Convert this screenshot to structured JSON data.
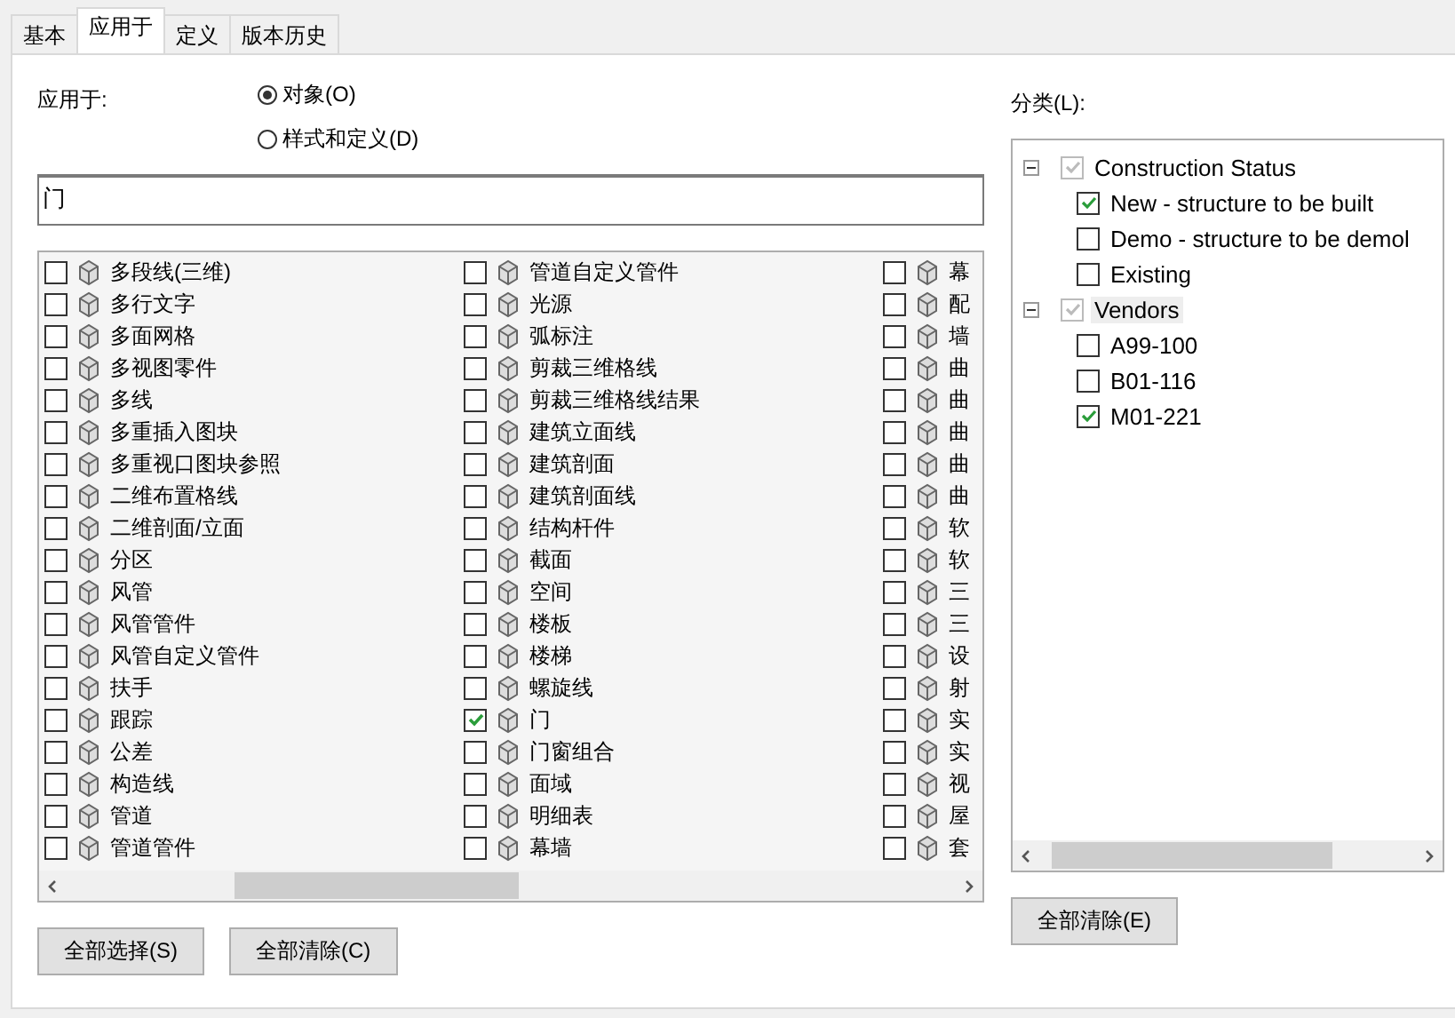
{
  "tabs": [
    {
      "label": "基本",
      "selected": false
    },
    {
      "label": "应用于",
      "selected": true
    },
    {
      "label": "定义",
      "selected": false
    },
    {
      "label": "版本历史",
      "selected": false
    }
  ],
  "apply_to": {
    "label": "应用于:",
    "options": [
      {
        "label": "对象(O)",
        "selected": true
      },
      {
        "label": "样式和定义(D)",
        "selected": false
      }
    ]
  },
  "filter": {
    "value": "门"
  },
  "object_list": {
    "columns": [
      [
        {
          "label": "多段线(三维)",
          "checked": false
        },
        {
          "label": "多行文字",
          "checked": false
        },
        {
          "label": "多面网格",
          "checked": false
        },
        {
          "label": "多视图零件",
          "checked": false
        },
        {
          "label": "多线",
          "checked": false
        },
        {
          "label": "多重插入图块",
          "checked": false
        },
        {
          "label": "多重视口图块参照",
          "checked": false
        },
        {
          "label": "二维布置格线",
          "checked": false
        },
        {
          "label": "二维剖面/立面",
          "checked": false
        },
        {
          "label": "分区",
          "checked": false
        },
        {
          "label": "风管",
          "checked": false
        },
        {
          "label": "风管管件",
          "checked": false
        },
        {
          "label": "风管自定义管件",
          "checked": false
        },
        {
          "label": "扶手",
          "checked": false
        },
        {
          "label": "跟踪",
          "checked": false
        },
        {
          "label": "公差",
          "checked": false
        },
        {
          "label": "构造线",
          "checked": false
        },
        {
          "label": "管道",
          "checked": false
        },
        {
          "label": "管道管件",
          "checked": false
        }
      ],
      [
        {
          "label": "管道自定义管件",
          "checked": false
        },
        {
          "label": "光源",
          "checked": false
        },
        {
          "label": "弧标注",
          "checked": false
        },
        {
          "label": "剪裁三维格线",
          "checked": false
        },
        {
          "label": "剪裁三维格线结果",
          "checked": false
        },
        {
          "label": "建筑立面线",
          "checked": false
        },
        {
          "label": "建筑剖面",
          "checked": false
        },
        {
          "label": "建筑剖面线",
          "checked": false
        },
        {
          "label": "结构杆件",
          "checked": false
        },
        {
          "label": "截面",
          "checked": false
        },
        {
          "label": "空间",
          "checked": false
        },
        {
          "label": "楼板",
          "checked": false
        },
        {
          "label": "楼梯",
          "checked": false
        },
        {
          "label": "螺旋线",
          "checked": false
        },
        {
          "label": "门",
          "checked": true
        },
        {
          "label": "门窗组合",
          "checked": false
        },
        {
          "label": "面域",
          "checked": false
        },
        {
          "label": "明细表",
          "checked": false
        },
        {
          "label": "幕墙",
          "checked": false
        }
      ],
      [
        {
          "label": "幕",
          "checked": false
        },
        {
          "label": "配",
          "checked": false
        },
        {
          "label": "墙",
          "checked": false
        },
        {
          "label": "曲",
          "checked": false
        },
        {
          "label": "曲",
          "checked": false
        },
        {
          "label": "曲",
          "checked": false
        },
        {
          "label": "曲",
          "checked": false
        },
        {
          "label": "曲",
          "checked": false
        },
        {
          "label": "软",
          "checked": false
        },
        {
          "label": "软",
          "checked": false
        },
        {
          "label": "三",
          "checked": false
        },
        {
          "label": "三",
          "checked": false
        },
        {
          "label": "设",
          "checked": false
        },
        {
          "label": "射",
          "checked": false
        },
        {
          "label": "实",
          "checked": false
        },
        {
          "label": "实",
          "checked": false
        },
        {
          "label": "视",
          "checked": false
        },
        {
          "label": "屋",
          "checked": false
        },
        {
          "label": "套",
          "checked": false
        }
      ]
    ]
  },
  "classification": {
    "label": "分类(L):",
    "tree": [
      {
        "label": "Construction Status",
        "checked": true,
        "greyed": true,
        "expanded": true,
        "selected": false,
        "children": [
          {
            "label": "New - structure to be built",
            "checked": true,
            "selected": false
          },
          {
            "label": "Demo - structure to be demol",
            "checked": false,
            "selected": false
          },
          {
            "label": "Existing",
            "checked": false,
            "selected": false
          }
        ]
      },
      {
        "label": "Vendors",
        "checked": true,
        "greyed": true,
        "expanded": true,
        "selected": true,
        "children": [
          {
            "label": "A99-100",
            "checked": false,
            "selected": false
          },
          {
            "label": "B01-116",
            "checked": false,
            "selected": false
          },
          {
            "label": "M01-221",
            "checked": true,
            "selected": false
          }
        ]
      }
    ]
  },
  "buttons": {
    "select_all": "全部选择(S)",
    "clear_all": "全部清除(C)",
    "clear_classification": "全部清除(E)"
  }
}
